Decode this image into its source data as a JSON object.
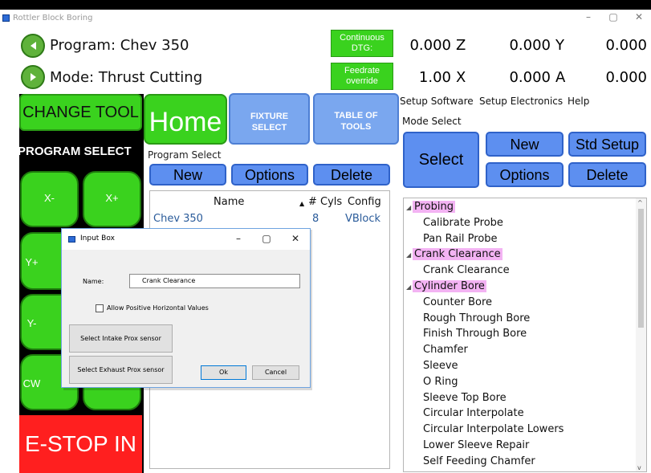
{
  "window": {
    "title": "Rottler Block Boring",
    "controls": [
      "–",
      "▢",
      "✕"
    ]
  },
  "header": {
    "program_label": "Program: Chev 350",
    "mode_label": "Mode: Thrust Cutting",
    "continuous_dtg": "Continuous DTG:",
    "feedrate_override": "Feedrate override"
  },
  "readouts": {
    "row1": [
      {
        "value": "0.000",
        "axis": "Z"
      },
      {
        "value": "0.000",
        "axis": "Y"
      },
      {
        "value": "0.000",
        "axis": ""
      }
    ],
    "row2": [
      {
        "value": "1.00",
        "axis": "X"
      },
      {
        "value": "0.000",
        "axis": "A"
      },
      {
        "value": "0.000",
        "axis": ""
      }
    ]
  },
  "left": {
    "change_tool": "CHANGE TOOL",
    "program_select": "PROGRAM SELECT",
    "jog": {
      "x_minus": "X-",
      "x_plus": "X+",
      "y_plus": "Y+",
      "y_minus": "Y-",
      "cw": "CW"
    },
    "estop": "E-STOP IN"
  },
  "nav": {
    "home": "Home",
    "fixture_select": "FIXTURE SELECT",
    "table_of_tools": "TABLE OF TOOLS"
  },
  "program_select": {
    "label": "Program Select",
    "new": "New",
    "options": "Options",
    "delete": "Delete",
    "columns": {
      "name": "Name",
      "cyls": "# Cyls",
      "config": "Config"
    },
    "rows": [
      {
        "name": "Chev 350",
        "cyls": "8",
        "config": "VBlock"
      }
    ]
  },
  "menu": {
    "setup_software": "Setup Software",
    "setup_electronics": "Setup Electronics",
    "help": "Help"
  },
  "mode_select": {
    "label": "Mode Select",
    "select": "Select",
    "new": "New",
    "std_setup": "Std Setup",
    "options": "Options",
    "delete": "Delete"
  },
  "tree": [
    {
      "label": "Probing",
      "category": true
    },
    {
      "label": "Calibrate Probe",
      "category": false
    },
    {
      "label": "Pan Rail Probe",
      "category": false
    },
    {
      "label": "Crank Clearance",
      "category": true
    },
    {
      "label": "Crank Clearance",
      "category": false
    },
    {
      "label": "Cylinder Bore",
      "category": true
    },
    {
      "label": "Counter Bore",
      "category": false
    },
    {
      "label": "Rough Through Bore",
      "category": false
    },
    {
      "label": "Finish Through Bore",
      "category": false
    },
    {
      "label": "Chamfer",
      "category": false
    },
    {
      "label": "Sleeve",
      "category": false
    },
    {
      "label": "O Ring",
      "category": false
    },
    {
      "label": "Sleeve Top Bore",
      "category": false
    },
    {
      "label": "Circular Interpolate",
      "category": false
    },
    {
      "label": "Circular Interpolate Lowers",
      "category": false
    },
    {
      "label": "Lower Sleeve Repair",
      "category": false
    },
    {
      "label": "Self Feeding Chamfer",
      "category": false
    }
  ],
  "dialog": {
    "title": "Input Box",
    "name_label": "Name:",
    "name_value": "Crank Clearance",
    "allow_positive": "Allow Positive Horizontal Values",
    "intake_prox": "Select Intake Prox sensor",
    "exhaust_prox": "Select Exhaust Prox sensor",
    "ok": "Ok",
    "cancel": "Cancel"
  },
  "colors": {
    "green": "#3ad21e",
    "blue_button": "#5d8ff0",
    "blue_tile": "#7aa7ef",
    "estop_red": "#ff1f1f",
    "tree_highlight": "#f3b3f3"
  }
}
